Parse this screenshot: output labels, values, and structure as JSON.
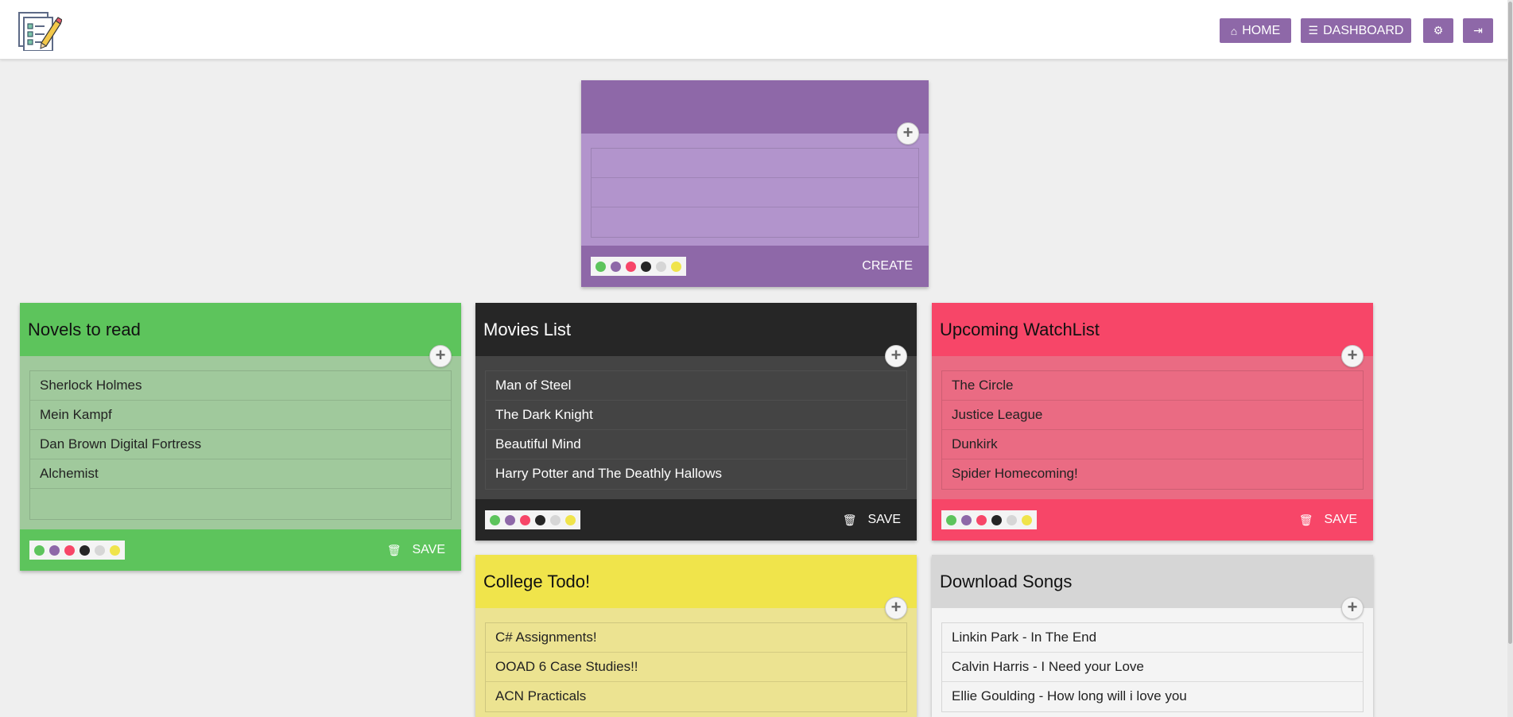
{
  "nav": {
    "home_label": "HOME",
    "dashboard_label": "DASHBOARD"
  },
  "colors": {
    "purple": "#8e68a8",
    "green": "#5dc45c",
    "red": "#f74668",
    "dark": "#262626",
    "light": "#d6d6d6",
    "yellow": "#f0e44b"
  },
  "new_card": {
    "title": "",
    "items": [
      "",
      "",
      ""
    ],
    "create_label": "CREATE"
  },
  "cards": [
    {
      "title": "Novels to read",
      "items": [
        "Sherlock Holmes",
        "Mein Kampf",
        "Dan Brown Digital Fortress",
        "Alchemist",
        ""
      ],
      "save_label": "SAVE"
    },
    {
      "title": "Movies List",
      "items": [
        "Man of Steel",
        "The Dark Knight",
        "Beautiful Mind",
        "Harry Potter and The Deathly Hallows"
      ],
      "save_label": "SAVE"
    },
    {
      "title": "Upcoming WatchList",
      "items": [
        "The Circle",
        "Justice League",
        "Dunkirk",
        "Spider Homecoming!"
      ],
      "save_label": "SAVE"
    },
    {
      "title": "College Todo!",
      "items": [
        "C# Assignments!",
        "OOAD 6 Case Studies!!",
        "ACN Practicals"
      ]
    },
    {
      "title": "Download Songs",
      "items": [
        "Linkin Park - In The End",
        "Calvin Harris - I Need your Love",
        "Ellie Goulding - How long will i love you"
      ]
    }
  ]
}
